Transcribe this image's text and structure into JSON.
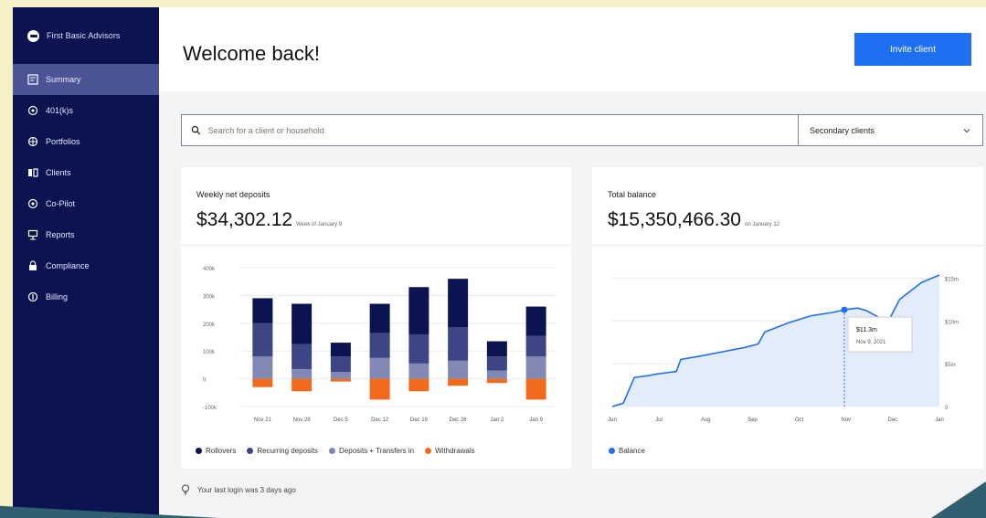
{
  "app": {
    "brand": "First Basic Advisors"
  },
  "sidebar": {
    "items": [
      {
        "label": "Summary",
        "icon": "summary-icon",
        "active": true
      },
      {
        "label": "401(k)s",
        "icon": "piggy-icon",
        "active": false
      },
      {
        "label": "Portfolios",
        "icon": "portfolio-icon",
        "active": false
      },
      {
        "label": "Clients",
        "icon": "clients-icon",
        "active": false
      },
      {
        "label": "Co-Pilot",
        "icon": "copilot-icon",
        "active": false
      },
      {
        "label": "Reports",
        "icon": "reports-icon",
        "active": false
      },
      {
        "label": "Compliance",
        "icon": "lock-icon",
        "active": false
      },
      {
        "label": "Billing",
        "icon": "billing-icon",
        "active": false
      }
    ]
  },
  "header": {
    "title": "Welcome back!",
    "invite_label": "Invite client"
  },
  "search": {
    "placeholder": "Search for a client or household",
    "dropdown_value": "Secondary clients"
  },
  "deposits_card": {
    "label": "Weekly net deposits",
    "value": "$34,302.12",
    "sub": "Week of January 9"
  },
  "balance_card": {
    "label": "Total balance",
    "value": "$15,350,466.30",
    "sub": "on January 12",
    "tooltip_value": "$11.3m",
    "tooltip_date": "Nov 9, 2021"
  },
  "footer": {
    "login_note": "Your last login was 3 days ago"
  },
  "colors": {
    "sidebar": "#0b1350",
    "rollovers": "#0b1350",
    "recurring": "#3d4585",
    "deposits_transfers": "#8088b3",
    "withdrawals": "#f26b1d",
    "balance_line": "#1f6ff2",
    "balance_fill": "#e3ecfb",
    "button": "#1f6ff2"
  },
  "chart_data": [
    {
      "type": "bar",
      "title": "Weekly net deposits",
      "categories": [
        "Nov 21",
        "Nov 28",
        "Dec 5",
        "Dec 12",
        "Dec 19",
        "Dec 26",
        "Jan 2",
        "Jan 9"
      ],
      "series": [
        {
          "name": "Rollovers",
          "values": [
            90,
            145,
            50,
            105,
            170,
            175,
            55,
            105
          ]
        },
        {
          "name": "Recurring deposits",
          "values": [
            120,
            90,
            55,
            90,
            105,
            120,
            50,
            75
          ]
        },
        {
          "name": "Deposits + Transfers in",
          "values": [
            80,
            35,
            25,
            75,
            55,
            65,
            30,
            80
          ]
        },
        {
          "name": "Withdrawals",
          "values": [
            -30,
            -45,
            -10,
            -75,
            -45,
            -25,
            -15,
            -75
          ]
        }
      ],
      "ylim": [
        -100,
        400
      ],
      "yticks": [
        -100,
        0,
        100,
        200,
        300,
        400
      ],
      "ytick_labels": [
        "-100k",
        "0",
        "100k",
        "200k",
        "300k",
        "400k"
      ],
      "legend": "bottom-left",
      "grid": true
    },
    {
      "type": "area",
      "title": "Total balance",
      "xtick_labels": [
        "Jun",
        "Jul",
        "Aug",
        "Sep",
        "Oct",
        "Nov",
        "Dec",
        "Jan"
      ],
      "x": [
        0,
        0.25,
        0.5,
        0.8,
        1.0,
        1.3,
        1.45,
        1.55,
        2.0,
        2.5,
        3.0,
        3.3,
        3.45,
        4.0,
        4.5,
        5.0,
        5.25,
        5.55,
        5.75,
        6.0,
        6.2,
        6.5,
        7.0,
        7.4
      ],
      "y": [
        0,
        0.4,
        3.4,
        3.6,
        3.8,
        4.0,
        4.1,
        5.5,
        5.9,
        6.4,
        6.9,
        7.3,
        8.7,
        9.8,
        10.6,
        11.0,
        11.3,
        11.5,
        11.2,
        10.5,
        9.5,
        12.5,
        14.5,
        15.35
      ],
      "ylim": [
        0,
        16
      ],
      "yticks": [
        0,
        5,
        10,
        15
      ],
      "ytick_labels": [
        "0",
        "$5m",
        "$10m",
        "$15m"
      ],
      "highlight_index": 16,
      "series_name": "Balance",
      "legend": "bottom-left",
      "grid": true
    }
  ]
}
